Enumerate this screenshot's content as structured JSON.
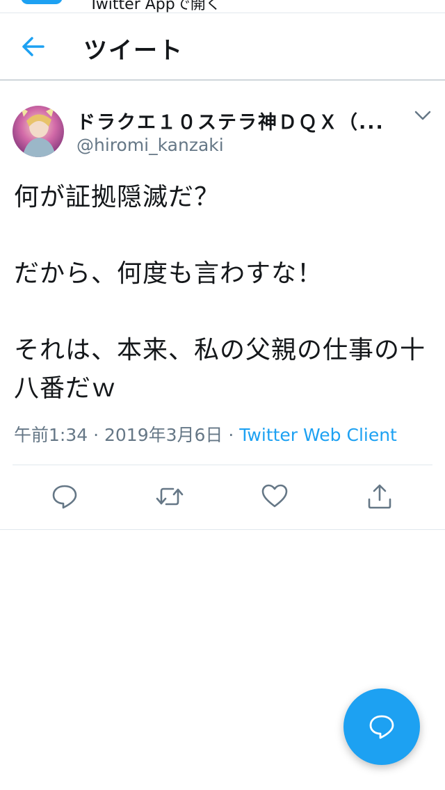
{
  "banner": {
    "text": "Twitter Appで開く"
  },
  "header": {
    "title": "ツイート"
  },
  "tweet": {
    "display_name": "ドラクエ１０ステラ神ＤＱＸ（...",
    "handle": "@hiromi_kanzaki",
    "body": "何が証拠隠滅だ？\n\nだから、何度も言わすな！\n\nそれは、本来、私の父親の仕事の十八番だｗ",
    "time": "午前1:34",
    "date": "2019年3月6日",
    "separator": "·",
    "client": "Twitter Web Client"
  },
  "colors": {
    "accent": "#1da1f2",
    "secondary_text": "#657786",
    "icon": "#657786"
  },
  "icons": {
    "back": "back-arrow-icon",
    "caret": "chevron-down-icon",
    "reply": "reply-icon",
    "retweet": "retweet-icon",
    "like": "heart-icon",
    "share": "share-icon",
    "compose": "compose-bubble-icon"
  }
}
